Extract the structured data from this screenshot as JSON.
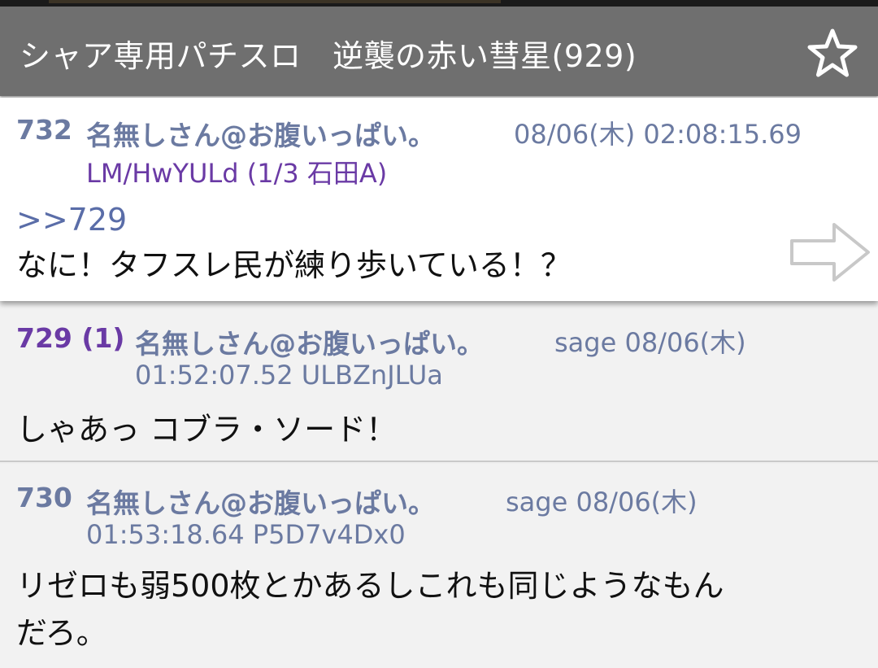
{
  "header": {
    "title": "シャア専用パチスロ　逆襲の赤い彗星(929)",
    "star_icon": "star-outline-icon"
  },
  "posts": [
    {
      "number": "732",
      "name": "名無しさん@お腹いっぱい。",
      "date": "08/06(木) 02:08:15.69",
      "id_line": "LM/HwYULd (1/3 石田A)",
      "anchor": ">>729",
      "text": "なに！タフスレ民が練り歩いている！？",
      "arrow_icon": "right-arrow-icon"
    },
    {
      "number": "729 (1)",
      "name": "名無しさん@お腹いっぱい。",
      "date": "sage 08/06(木)",
      "id_line": "01:52:07.52 ULBZnJLUa",
      "text": "しゃあっ コブラ・ソード！"
    },
    {
      "number": "730",
      "name": "名無しさん@お腹いっぱい。",
      "date": "sage 08/06(木)",
      "id_line": "01:53:18.64 P5D7v4Dx0",
      "text_line1": "リゼロも弱500枚とかあるしこれも同じようなもん",
      "text_line2": "だろ。"
    }
  ],
  "colors": {
    "titlebar": "#6f6f6f",
    "name": "#6b7aa1",
    "purple": "#6a3aa5",
    "number": "#6b7aa1"
  }
}
